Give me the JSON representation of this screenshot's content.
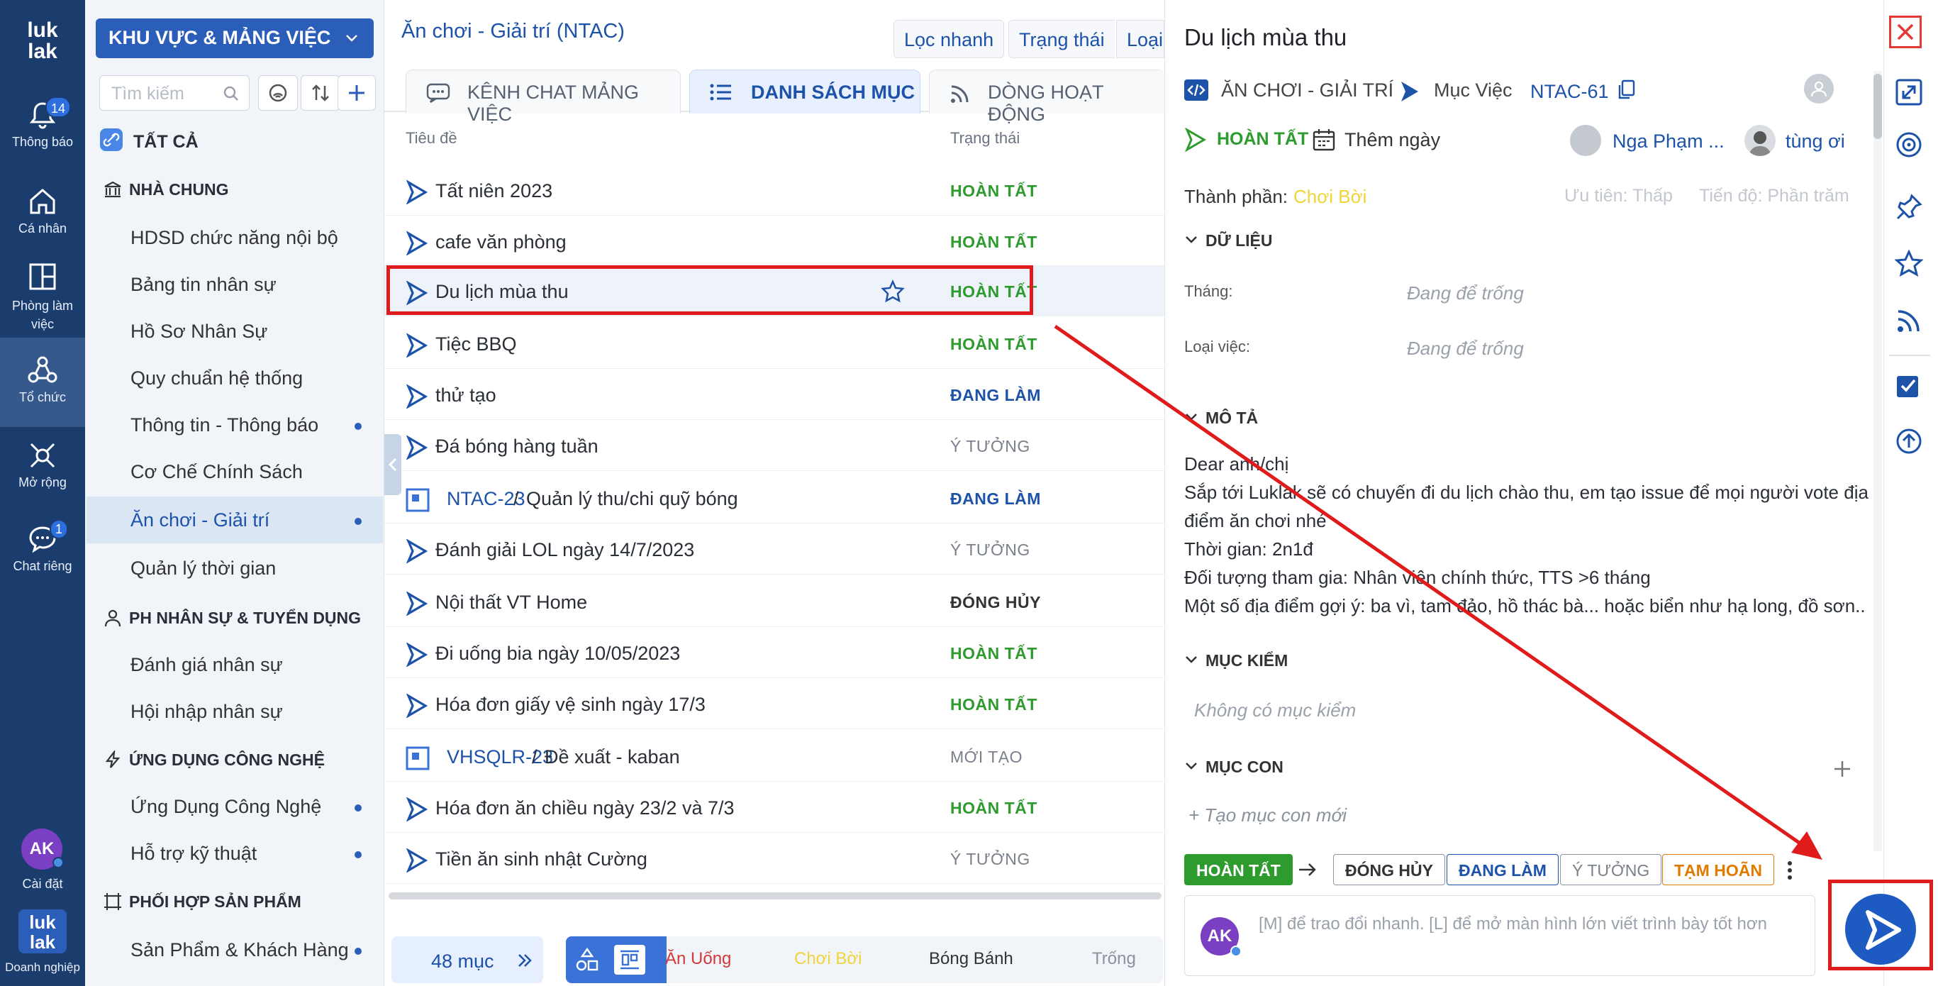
{
  "rail": {
    "logo": "luk lak",
    "items": [
      {
        "label": "Thông báo",
        "badge": "14",
        "icon": "bell-icon"
      },
      {
        "label": "Cá nhân",
        "icon": "home-icon"
      },
      {
        "label": "Phòng làm việc",
        "icon": "layout-icon"
      },
      {
        "label": "Tổ chức",
        "icon": "organization-icon"
      },
      {
        "label": "Mở rộng",
        "icon": "extend-icon"
      },
      {
        "label": "Chat riêng",
        "badge": "1",
        "icon": "chat-icon"
      }
    ],
    "avatar": "AK",
    "settings_label": "Cài đặt",
    "org_logo": "luk lak",
    "org_label": "Doanh nghiệp"
  },
  "sidebar": {
    "workspace": "KHU VỰC & MẢNG VIỆC",
    "search_placeholder": "Tìm kiếm",
    "all_label": "TẤT CẢ",
    "groups": [
      {
        "title": "NHÀ CHUNG",
        "icon": "bank-icon",
        "items": [
          {
            "label": "HDSD chức năng nội bộ",
            "dot": false
          },
          {
            "label": "Bảng tin nhân sự",
            "dot": false
          },
          {
            "label": "Hồ Sơ Nhân Sự",
            "dot": false
          },
          {
            "label": "Quy chuẩn hệ thống",
            "dot": false
          },
          {
            "label": "Thông tin - Thông báo",
            "dot": true
          },
          {
            "label": "Cơ Chế Chính Sách",
            "dot": false
          },
          {
            "label": "Ăn chơi - Giải trí",
            "dot": true,
            "selected": true
          },
          {
            "label": "Quản lý thời gian",
            "dot": false
          }
        ]
      },
      {
        "title": "PH NHÂN SỰ & TUYỂN DỤNG",
        "icon": "user-icon",
        "items": [
          {
            "label": "Đánh giá nhân sự",
            "dot": false
          },
          {
            "label": "Hội nhập nhân sự",
            "dot": false
          }
        ]
      },
      {
        "title": "ỨNG DỤNG CÔNG NGHỆ",
        "icon": "bolt-icon",
        "items": [
          {
            "label": "Ứng Dụng Công Nghệ",
            "dot": true
          },
          {
            "label": "Hỗ trợ kỹ thuật",
            "dot": true
          }
        ]
      },
      {
        "title": "PHỐI HỢP SẢN PHẨM",
        "icon": "frame-icon",
        "items": [
          {
            "label": "Sản Phẩm & Khách Hàng",
            "dot": true
          }
        ]
      }
    ]
  },
  "list": {
    "title": "Ăn chơi - Giải trí (NTAC)",
    "toolbar": [
      "Lọc nhanh",
      "Trạng thái",
      "Loại"
    ],
    "tabs": [
      "KÊNH CHAT MẢNG VIỆC",
      "DANH SÁCH MỤC",
      "DÒNG HOẠT ĐỘNG"
    ],
    "col_title": "Tiêu đề",
    "col_status": "Trạng thái",
    "rows": [
      {
        "title": "Tất niên 2023",
        "status": "HOÀN TẤT",
        "kind": "done"
      },
      {
        "title": "cafe văn phòng",
        "status": "HOÀN TẤT",
        "kind": "done"
      },
      {
        "title": "Du lịch mùa thu",
        "status": "HOÀN TẤT",
        "kind": "done",
        "selected": true
      },
      {
        "title": "Tiệc BBQ",
        "status": "HOÀN TẤT",
        "kind": "done"
      },
      {
        "title": "thử tạo",
        "status": "ĐANG LÀM",
        "kind": "doing"
      },
      {
        "title": "Đá bóng hàng tuần",
        "status": "Ý TƯỞNG",
        "kind": "idea"
      },
      {
        "key": "NTAC-23",
        "title": "Quản lý thu/chi quỹ bóng",
        "status": "ĐANG LÀM",
        "kind": "doing"
      },
      {
        "title": "Đánh giải LOL ngày 14/7/2023",
        "status": "Ý TƯỞNG",
        "kind": "idea"
      },
      {
        "title": "Nội thất VT Home",
        "status": "ĐÓNG HỦY",
        "kind": "cancel"
      },
      {
        "title": "Đi uống bia ngày 10/05/2023",
        "status": "HOÀN TẤT",
        "kind": "done"
      },
      {
        "title": "Hóa đơn giấy vệ sinh ngày 17/3",
        "status": "HOÀN TẤT",
        "kind": "done"
      },
      {
        "key": "VHSQLR-23",
        "title": "Đề xuất - kaban",
        "status": "MỚI TẠO",
        "kind": "new"
      },
      {
        "title": "Hóa đơn ăn chiều ngày 23/2 và 7/3",
        "status": "HOÀN TẤT",
        "kind": "done"
      },
      {
        "title": "Tiền ăn sinh nhật Cường",
        "status": "Ý TƯỞNG",
        "kind": "idea"
      }
    ],
    "count": "48 mục",
    "footer_chips": [
      {
        "label": "Ăn Uống",
        "color": "#d23a3a"
      },
      {
        "label": "Chơi Bời",
        "color": "#f0d43a"
      },
      {
        "label": "Bóng Bánh",
        "color": "#333333"
      },
      {
        "label": "Trống",
        "color": "#8a929c"
      }
    ]
  },
  "detail": {
    "title": "Du lịch mùa thu",
    "breadcrumb": "ĂN CHƠI - GIẢI TRÍ",
    "type": "Mục Việc",
    "key": "NTAC-61",
    "status": "HOÀN TẤT",
    "add_date": "Thêm ngày",
    "assignee": "Nga Phạm ...",
    "reporter": "tùng ơi",
    "component_label": "Thành phần:",
    "component_value": "Chơi Bời",
    "priority": "Ưu tiên: Thấp",
    "progress": "Tiến độ: Phần trăm",
    "data_section": "DỮ LIỆU",
    "fields": [
      {
        "label": "Tháng:",
        "value": "Đang để trống"
      },
      {
        "label": "Loại việc:",
        "value": "Đang để trống"
      }
    ],
    "desc_section": "MÔ TẢ",
    "description": [
      "Dear anh/chị",
      "Sắp tới Luklak sẽ có chuyến đi du lịch chào thu, em tạo issue để mọi người vote địa",
      "điểm ăn chơi nhé",
      "Thời gian: 2n1đ",
      "Đối tượng tham gia: Nhân viên chính thức, TTS >6 tháng",
      "Một số địa điểm gợi ý: ba vì, tam đảo, hồ thác bà... hoặc biển như hạ long, đồ sơn.."
    ],
    "checklist_section": "MỤC KIỂM",
    "checklist_empty": "Không có mục kiểm",
    "children_section": "MỤC CON",
    "new_child": "+ Tạo mục con mới",
    "current_status": "HOÀN TẤT",
    "transitions": [
      "ĐÓNG HỦY",
      "ĐANG LÀM",
      "Ý TƯỞNG",
      "TẠM HOÃN"
    ],
    "comment_avatar": "AK",
    "comment_placeholder": "[M] để trao đổi nhanh. [L] để mở màn hình lớn viết trình bày tốt hơn"
  },
  "colors": {
    "rail": "#1b3d6e",
    "accent": "#2b5eb8",
    "done": "#2e9b2e",
    "annotation": "#e01b1b",
    "pause": "#e07b00"
  }
}
